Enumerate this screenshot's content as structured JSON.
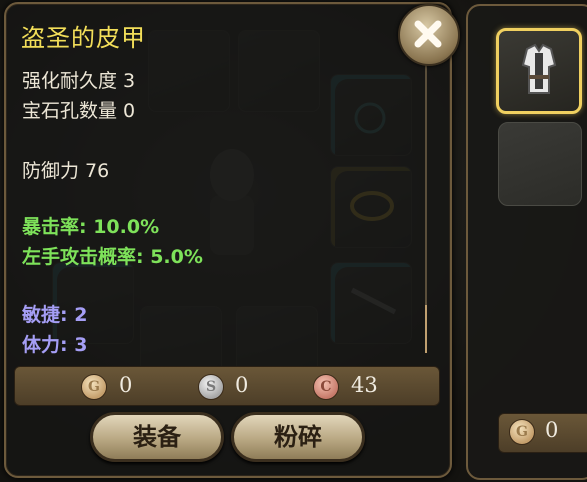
{
  "item": {
    "name": "盗圣的皮甲",
    "stats_basic": [
      "强化耐久度 3",
      "宝石孔数量 0"
    ],
    "defense": "防御力 76",
    "bonus_green": [
      "暴击率: 10.0%",
      "左手攻击概率: 5.0%"
    ],
    "bonus_blue": [
      "敏捷: 2",
      "体力: 3"
    ]
  },
  "price": {
    "gold": {
      "icon": "G",
      "amount": "0"
    },
    "silver": {
      "icon": "S",
      "amount": "0"
    },
    "copper": {
      "icon": "C",
      "amount": "43"
    }
  },
  "buttons": {
    "equip": "装备",
    "shatter": "粉碎"
  },
  "side": {
    "gold_icon": "G",
    "gold_amount": "0"
  },
  "icons": [
    "close-icon",
    "leather-armor-icon",
    "gold-coin-icon",
    "silver-coin-icon",
    "copper-coin-icon"
  ],
  "colors": {
    "title": "#f2de59",
    "green_stat": "#7ee25a",
    "blue_stat": "#a59ef5",
    "selected_border": "#f0d060"
  }
}
